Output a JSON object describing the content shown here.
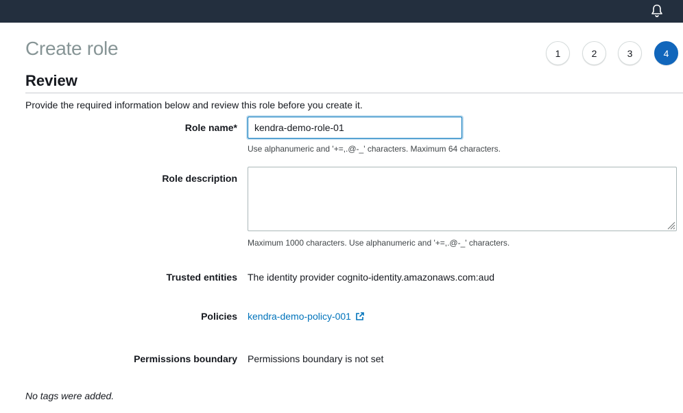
{
  "header": {
    "icon": "bell-icon"
  },
  "page": {
    "title": "Create role"
  },
  "steps": [
    "1",
    "2",
    "3",
    "4"
  ],
  "active_step": "4",
  "review": {
    "title": "Review",
    "intro": "Provide the required information below and review this role before you create it."
  },
  "role_name": {
    "label": "Role name*",
    "value": "kendra-demo-role-01",
    "hint": "Use alphanumeric and '+=,.@-_' characters. Maximum 64 characters."
  },
  "role_description": {
    "label": "Role description",
    "value": "",
    "hint": "Maximum 1000 characters. Use alphanumeric and '+=,.@-_' characters."
  },
  "trusted_entities": {
    "label": "Trusted entities",
    "value": "The identity provider cognito-identity.amazonaws.com:aud"
  },
  "policies": {
    "label": "Policies",
    "link": "kendra-demo-policy-001",
    "icon": "external-link-icon"
  },
  "permissions_boundary": {
    "label": "Permissions boundary",
    "value": "Permissions boundary is not set"
  },
  "tags": {
    "empty_text": "No tags were added."
  },
  "colors": {
    "header_bg": "#232f3e",
    "accent": "#1166bb",
    "link": "#0073bb"
  }
}
